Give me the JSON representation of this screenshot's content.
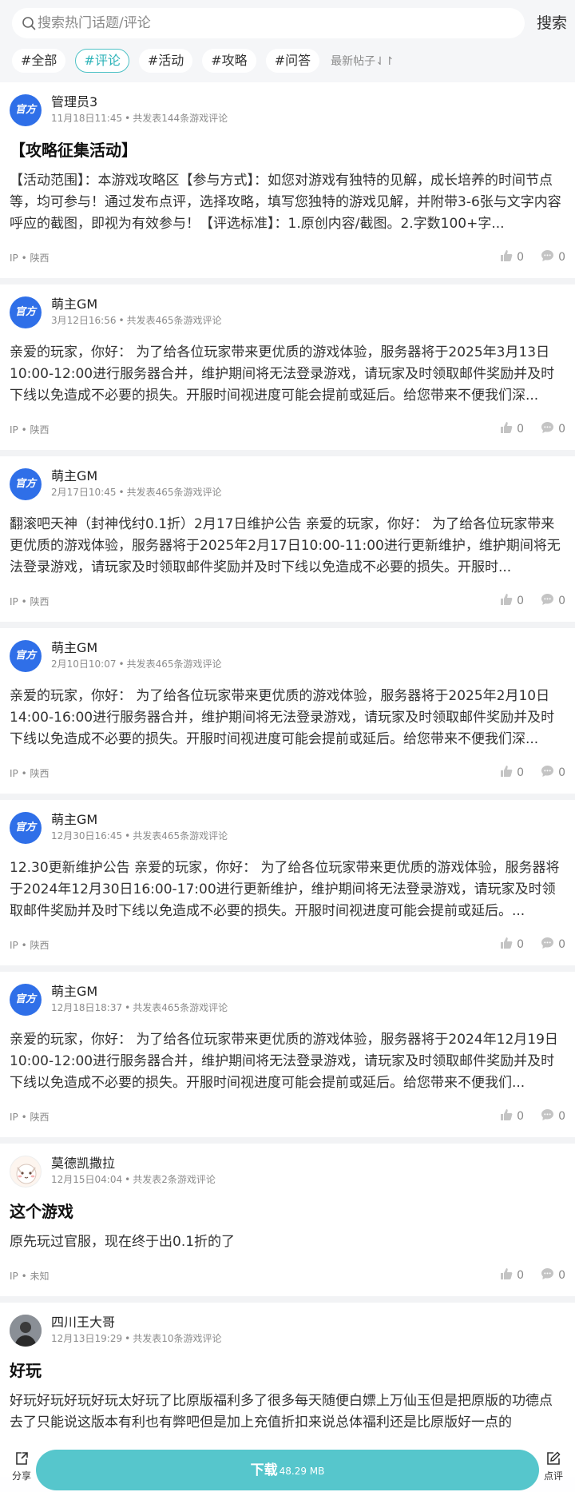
{
  "search": {
    "placeholder": "搜索热门话题/评论",
    "button_label": "搜索"
  },
  "filters": {
    "chips": [
      "#全部",
      "#评论",
      "#活动",
      "#攻略",
      "#问答"
    ],
    "active_index": 1,
    "sort_label": "最新帖子⇃↾"
  },
  "colors": {
    "accent": "#4ec2c6",
    "download_button": "#56c6cc",
    "official_badge": "#2f6fe8"
  },
  "posts": [
    {
      "avatar": "official-badge",
      "avatar_text": "官方",
      "username": "管理员3",
      "time": "11月18日11:45",
      "posts_count": "共发表144条游戏评论",
      "title": "【攻略征集活动】",
      "content": "【活动范围】：本游戏攻略区【参与方式】：如您对游戏有独特的见解，成长培养的时间节点等，均可参与！通过发布点评，选择攻略，填写您独特的游戏见解，并附带3-6张与文字内容呼应的截图，即视为有效参与！【评选标准】：1.原创内容/截图。2.字数100+字...",
      "ip": "IP • 陕西",
      "likes": "0",
      "comments": "0"
    },
    {
      "avatar": "official-badge",
      "avatar_text": "官方",
      "username": "萌主GM",
      "time": "3月12日16:56",
      "posts_count": "共发表465条游戏评论",
      "title": "",
      "content": "亲爱的玩家，你好： 为了给各位玩家带来更优质的游戏体验，服务器将于2025年3月13日10:00-12:00进行服务器合并，维护期间将无法登录游戏，请玩家及时领取邮件奖励并及时下线以免造成不必要的损失。开服时间视进度可能会提前或延后。给您带来不便我们深...",
      "ip": "IP • 陕西",
      "likes": "0",
      "comments": "0"
    },
    {
      "avatar": "official-badge",
      "avatar_text": "官方",
      "username": "萌主GM",
      "time": "2月17日10:45",
      "posts_count": "共发表465条游戏评论",
      "title": "",
      "content": "翻滚吧天神（封神伐纣0.1折）2月17日维护公告 亲爱的玩家，你好： 为了给各位玩家带来更优质的游戏体验，服务器将于2025年2月17日10:00-11:00进行更新维护，维护期间将无法登录游戏，请玩家及时领取邮件奖励并及时下线以免造成不必要的损失。开服时...",
      "ip": "IP • 陕西",
      "likes": "0",
      "comments": "0"
    },
    {
      "avatar": "official-badge",
      "avatar_text": "官方",
      "username": "萌主GM",
      "time": "2月10日10:07",
      "posts_count": "共发表465条游戏评论",
      "title": "",
      "content": "亲爱的玩家，你好： 为了给各位玩家带来更优质的游戏体验，服务器将于2025年2月10日14:00-16:00进行服务器合并，维护期间将无法登录游戏，请玩家及时领取邮件奖励并及时下线以免造成不必要的损失。开服时间视进度可能会提前或延后。给您带来不便我们深...",
      "ip": "IP • 陕西",
      "likes": "0",
      "comments": "0"
    },
    {
      "avatar": "official-badge",
      "avatar_text": "官方",
      "username": "萌主GM",
      "time": "12月30日16:45",
      "posts_count": "共发表465条游戏评论",
      "title": "",
      "content": "12.30更新维护公告 亲爱的玩家，你好： 为了给各位玩家带来更优质的游戏体验，服务器将于2024年12月30日16:00-17:00进行更新维护，维护期间将无法登录游戏，请玩家及时领取邮件奖励并及时下线以免造成不必要的损失。开服时间视进度可能会提前或延后。...",
      "ip": "IP • 陕西",
      "likes": "0",
      "comments": "0"
    },
    {
      "avatar": "official-badge",
      "avatar_text": "官方",
      "username": "萌主GM",
      "time": "12月18日18:37",
      "posts_count": "共发表465条游戏评论",
      "title": "",
      "content": "亲爱的玩家，你好： 为了给各位玩家带来更优质的游戏体验，服务器将于2024年12月19日10:00-12:00进行服务器合并，维护期间将无法登录游戏，请玩家及时领取邮件奖励并及时下线以免造成不必要的损失。开服时间视进度可能会提前或延后。给您带来不便我们...",
      "ip": "IP • 陕西",
      "likes": "0",
      "comments": "0"
    },
    {
      "avatar": "cat-avatar",
      "avatar_text": "",
      "username": "莫德凯撒拉",
      "time": "12月15日04:04",
      "posts_count": "共发表2条游戏评论",
      "title": "这个游戏",
      "content": "原先玩过官服，现在终于出0.1折的了",
      "ip": "IP • 未知",
      "likes": "0",
      "comments": "0"
    },
    {
      "avatar": "man-avatar",
      "avatar_text": "",
      "username": "四川王大哥",
      "time": "12月13日19:29",
      "posts_count": "共发表10条游戏评论",
      "title": "好玩",
      "content": "好玩好玩好玩好玩太好玩了比原版福利多了很多每天随便白嫖上万仙玉但是把原版的功德点去了只能说这版本有利也有弊吧但是加上充值折扣来说总体福利还是比原版好一点的",
      "ip": "",
      "likes": "",
      "comments": ""
    }
  ],
  "bottom_bar": {
    "share_label": "分享",
    "download_label": "下载",
    "download_size": "48.29 MB",
    "review_label": "点评"
  }
}
